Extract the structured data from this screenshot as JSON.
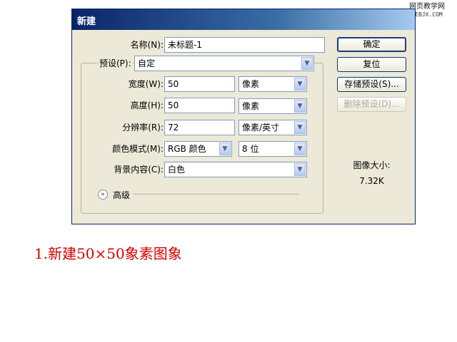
{
  "watermark": {
    "cn": "网页教学网",
    "url": "WEBJX.COM"
  },
  "dialog": {
    "title": "新建",
    "name": {
      "label": "名称(N):",
      "value": "未标题-1"
    },
    "preset": {
      "label": "预设(P):",
      "value": "自定"
    },
    "width": {
      "label": "宽度(W):",
      "value": "50",
      "unit": "像素"
    },
    "height": {
      "label": "高度(H):",
      "value": "50",
      "unit": "像素"
    },
    "resolution": {
      "label": "分辨率(R):",
      "value": "72",
      "unit": "像素/英寸"
    },
    "color_mode": {
      "label": "颜色模式(M):",
      "value": "RGB 颜色",
      "depth": "8 位"
    },
    "background": {
      "label": "背景内容(C):",
      "value": "白色"
    },
    "advanced": {
      "label": "高级"
    },
    "buttons": {
      "ok": "确定",
      "reset": "复位",
      "save_preset": "存储预设(S)...",
      "delete_preset": "删除预设(D)..."
    },
    "image_size": {
      "label": "图像大小:",
      "value": "7.32K"
    }
  },
  "caption": "1.新建50×50象素图象"
}
